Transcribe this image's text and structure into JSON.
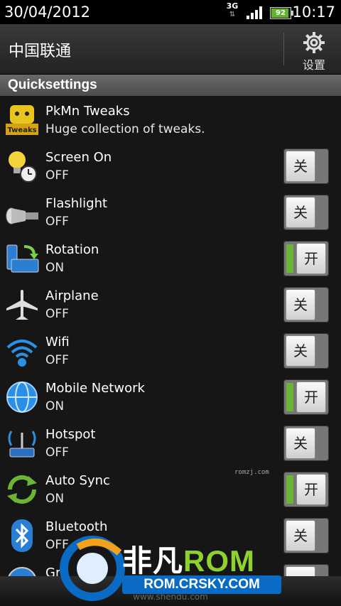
{
  "status_bar": {
    "date": "30/04/2012",
    "network_type": "3G",
    "battery_level": "92",
    "time": "10:17"
  },
  "header": {
    "carrier": "中国联通",
    "settings_label": "设置"
  },
  "section": {
    "title": "Quicksettings"
  },
  "items": [
    {
      "title": "PkMn Tweaks",
      "subtitle": "Huge collection of tweaks.",
      "icon": "pkmn-tweaks-icon"
    },
    {
      "title": "Screen On",
      "subtitle": "OFF",
      "icon": "screen-on-icon",
      "toggle": "关"
    },
    {
      "title": "Flashlight",
      "subtitle": "OFF",
      "icon": "flashlight-icon",
      "toggle": "关"
    },
    {
      "title": "Rotation",
      "subtitle": "ON",
      "icon": "rotation-icon",
      "toggle": "开"
    },
    {
      "title": "Airplane",
      "subtitle": "OFF",
      "icon": "airplane-icon",
      "toggle": "关"
    },
    {
      "title": "Wifi",
      "subtitle": "OFF",
      "icon": "wifi-icon",
      "toggle": "关"
    },
    {
      "title": "Mobile Network",
      "subtitle": "ON",
      "icon": "mobile-network-icon",
      "toggle": "开"
    },
    {
      "title": "Hotspot",
      "subtitle": "OFF",
      "icon": "hotspot-icon",
      "toggle": "关"
    },
    {
      "title": "Auto Sync",
      "subtitle": "ON",
      "icon": "auto-sync-icon",
      "toggle": "开"
    },
    {
      "title": "Bluetooth",
      "subtitle": "OFF",
      "icon": "bluetooth-icon",
      "toggle": "关"
    },
    {
      "title": "Gr",
      "subtitle": "",
      "icon": "gps-icon",
      "toggle": ""
    }
  ],
  "watermarks": {
    "small": "romzj.com",
    "brand_cn": "非凡",
    "brand_rom": "ROM",
    "brand_domain": "ROM.CRSKY.COM",
    "bottom_url": "www.shendu.com"
  },
  "colors": {
    "accent_on": "#6ab436",
    "brand_blue": "#0a6bc5",
    "brand_green": "#8ed22f"
  }
}
